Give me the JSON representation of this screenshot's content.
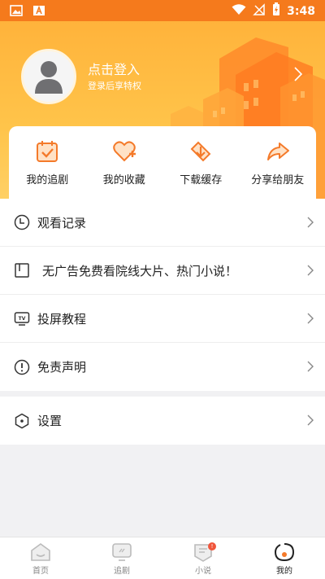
{
  "status_bar": {
    "time": "3:48"
  },
  "profile": {
    "login_title": "点击登入",
    "login_subtitle": "登录后享特权"
  },
  "quick_actions": [
    {
      "label": "我的追剧",
      "icon": "calendar-check-icon"
    },
    {
      "label": "我的收藏",
      "icon": "heart-plus-icon"
    },
    {
      "label": "下载缓存",
      "icon": "download-box-icon"
    },
    {
      "label": "分享给朋友",
      "icon": "share-arrow-icon"
    }
  ],
  "menu": [
    {
      "label": "观看记录",
      "icon": "clock-icon"
    },
    {
      "label": "无广告免费看院线大片、热门小说！",
      "icon": "book-icon"
    },
    {
      "label": "投屏教程",
      "icon": "tv-icon"
    },
    {
      "label": "免责声明",
      "icon": "exclamation-icon"
    }
  ],
  "settings": {
    "label": "设置",
    "icon": "settings-hex-icon"
  },
  "bottom_nav": [
    {
      "label": "首页",
      "icon": "home-icon",
      "active": false
    },
    {
      "label": "追剧",
      "icon": "tv-play-icon",
      "active": false
    },
    {
      "label": "小说",
      "icon": "novel-icon",
      "active": false,
      "badge": "!"
    },
    {
      "label": "我的",
      "icon": "profile-icon",
      "active": true
    }
  ],
  "colors": {
    "accent": "#f57a1c",
    "header_yellow": "#ffc44a",
    "icon_orange": "#f47a2a"
  }
}
